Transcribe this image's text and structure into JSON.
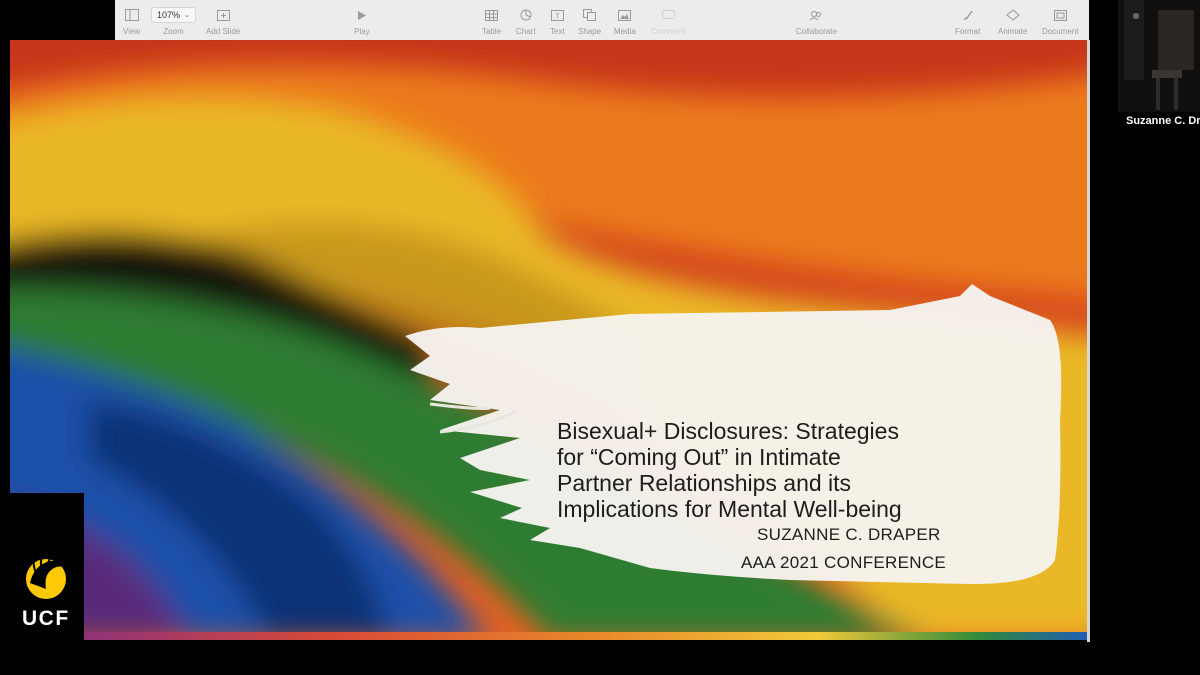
{
  "toolbar": {
    "view": "View",
    "zoom": "Zoom",
    "zoom_value": "107%",
    "add_slide": "Add Slide",
    "play": "Play",
    "table": "Table",
    "chart": "Chart",
    "text": "Text",
    "shape": "Shape",
    "media": "Media",
    "comment": "Comment",
    "collaborate": "Collaborate",
    "format": "Format",
    "animate": "Animate",
    "document": "Document"
  },
  "slide": {
    "title_lines": [
      "Bisexual+ Disclosures: Strategies",
      "for “Coming Out” in Intimate",
      "Partner Relationships and its",
      "Implications for Mental Well-being"
    ],
    "author": "SUZANNE C. DRAPER",
    "conference": "AAA 2021 CONFERENCE"
  },
  "logo": {
    "text": "UCF",
    "color": "#ffc904"
  },
  "participant": {
    "name": "Suzanne C. Dr"
  },
  "colors": {
    "toolbar_bg": "#ececec",
    "flag_red": "#d8431e",
    "flag_orange": "#ec7a1f",
    "flag_yellow": "#eab826",
    "flag_green": "#2f7c33",
    "flag_blue": "#1c4fa8",
    "flag_purple": "#5a2a7a",
    "brush_white": "#f6f4ef"
  }
}
